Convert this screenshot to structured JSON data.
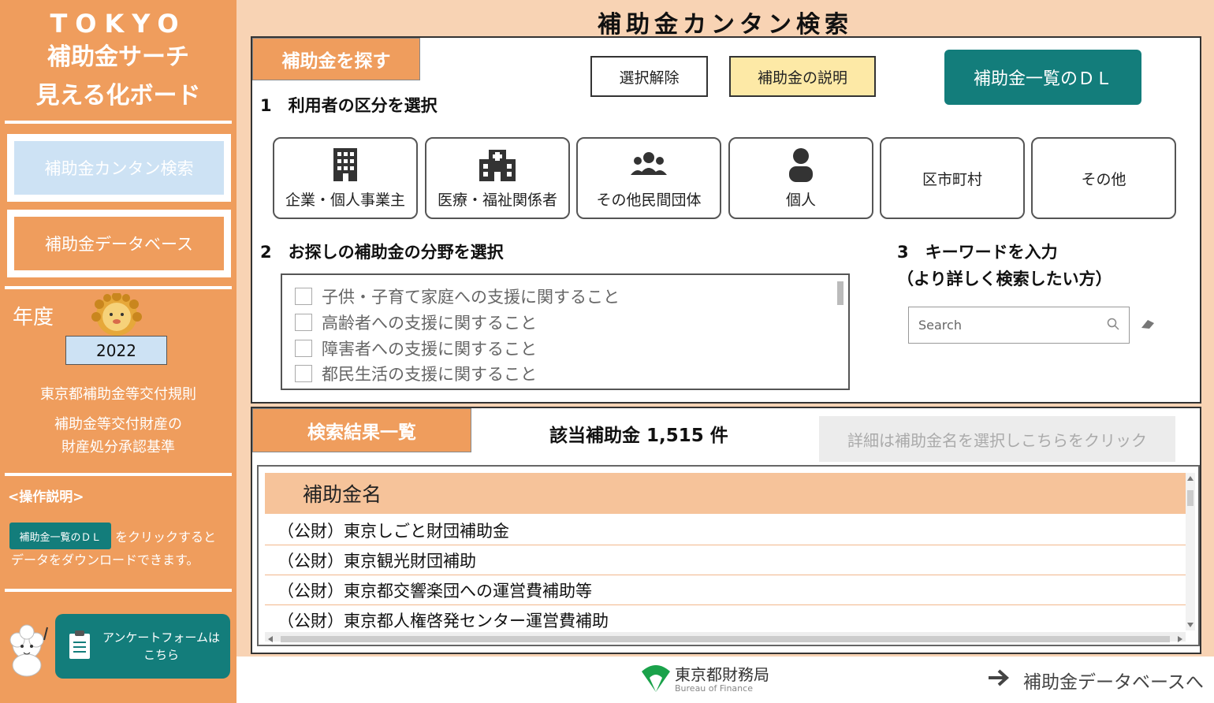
{
  "sidebar": {
    "brand_line1": "TOKYO",
    "brand_line2": "補助金サーチ",
    "brand_line3": "見える化ボード",
    "nav": [
      {
        "label": "補助金カンタン検索"
      },
      {
        "label": "補助金データベース"
      }
    ],
    "year_label": "年度",
    "year_value": "2022",
    "links": [
      {
        "label": "東京都補助金等交付規則"
      },
      {
        "label": "補助金等交付財産の"
      },
      {
        "label": "財産処分承認基準"
      }
    ],
    "help_title": "<操作説明>",
    "help_badge": "補助金一覧のＤＬ",
    "help_text1": "をクリックすると",
    "help_text2": "データをダウンロードできます。",
    "survey_line1": "アンケートフォームは",
    "survey_line2": "こちら"
  },
  "main": {
    "title": "補助金カンタン検索",
    "search_tab": "補助金を探す",
    "clear_button": "選択解除",
    "explain_button": "補助金の説明",
    "download_button": "補助金一覧のＤＬ",
    "step1": "1　利用者の区分を選択",
    "categories": [
      {
        "label": "企業・個人事業主",
        "icon": "building-icon"
      },
      {
        "label": "医療・福祉関係者",
        "icon": "hospital-icon"
      },
      {
        "label": "その他民間団体",
        "icon": "group-icon"
      },
      {
        "label": "個人",
        "icon": "person-icon"
      },
      {
        "label": "区市町村",
        "icon": ""
      },
      {
        "label": "その他",
        "icon": ""
      }
    ],
    "step2": "2　お探しの補助金の分野を選択",
    "fields": [
      {
        "label": "子供・子育て家庭への支援に関すること"
      },
      {
        "label": "高齢者への支援に関すること"
      },
      {
        "label": "障害者への支援に関すること"
      },
      {
        "label": "都民生活の支援に関すること"
      }
    ],
    "step3_line1": "3　キーワードを入力",
    "step3_line2": "（より詳しく検索したい方）",
    "search_placeholder": "Search"
  },
  "results": {
    "tab": "検索結果一覧",
    "count_text": "該当補助金 1,515 件",
    "detail_button": "詳細は補助金名を選択しこちらをクリック",
    "column_header": "補助金名",
    "rows": [
      {
        "name": "（公財）東京しごと財団補助金"
      },
      {
        "name": "（公財）東京観光財団補助"
      },
      {
        "name": "（公財）東京都交響楽団への運営費補助等"
      },
      {
        "name": "（公財）東京都人権啓発センター運営費補助"
      }
    ]
  },
  "footer": {
    "org_jp": "東京都財務局",
    "org_en": "Bureau of Finance",
    "to_database": "補助金データベースへ"
  },
  "colors": {
    "accent_orange": "#ef9d5d",
    "teal": "#137d7b",
    "light_blue": "#cde2f4",
    "yellow": "#fde9a6"
  }
}
